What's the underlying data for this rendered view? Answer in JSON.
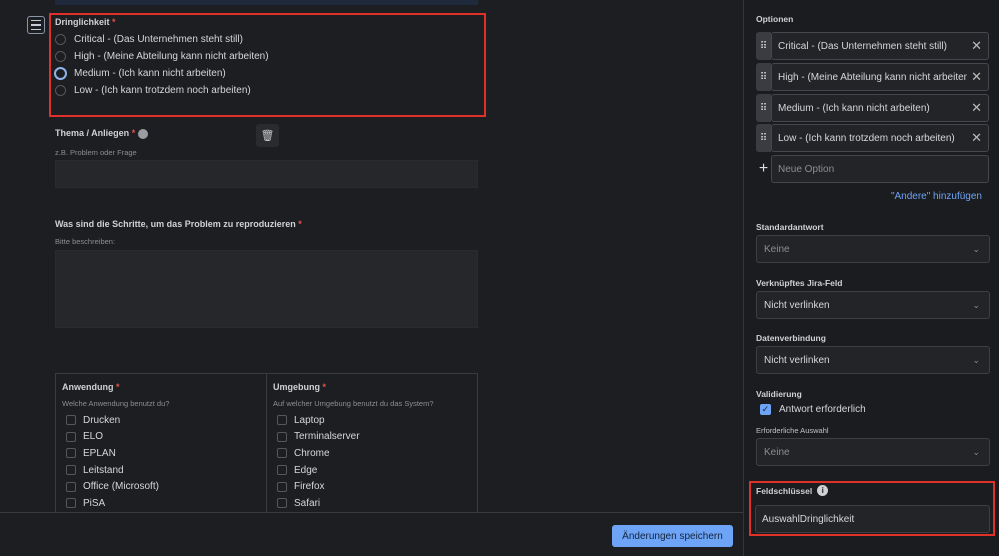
{
  "form": {
    "urgency": {
      "label": "Dringlichkeit",
      "required_mark": "*",
      "options": [
        "Critical - (Das Unternehmen steht still)",
        "High - (Meine Abteilung kann nicht arbeiten)",
        "Medium - (Ich kann nicht arbeiten)",
        "Low - (Ich kann trotzdem noch arbeiten)"
      ]
    },
    "topic": {
      "label": "Thema / Anliegen",
      "required_mark": "*",
      "hint": "z.B. Problem oder Frage"
    },
    "steps": {
      "label": "Was sind die Schritte, um das Problem zu reproduzieren",
      "required_mark": "*",
      "hint": "Bitte beschreiben:"
    },
    "application": {
      "label": "Anwendung",
      "required_mark": "*",
      "hint": "Welche Anwendung benutzt du?",
      "options": [
        "Drucken",
        "ELO",
        "EPLAN",
        "Leitstand",
        "Office (Microsoft)",
        "PiSA"
      ]
    },
    "environment": {
      "label": "Umgebung",
      "required_mark": "*",
      "hint": "Auf welcher Umgebung benutzt du das System?",
      "options": [
        "Laptop",
        "Terminalserver",
        "Chrome",
        "Edge",
        "Firefox",
        "Safari"
      ]
    }
  },
  "footer": {
    "save_label": "Änderungen speichern"
  },
  "panel": {
    "options_label": "Optionen",
    "options": [
      "Critical - (Das Unternehmen steht still)",
      "High - (Meine Abteilung kann nicht arbeiten)",
      "Medium - (Ich kann nicht arbeiten)",
      "Low - (Ich kann trotzdem noch arbeiten)"
    ],
    "new_option_placeholder": "Neue Option",
    "add_other": "\"Andere\" hinzufügen",
    "default_label": "Standardantwort",
    "default_value": "Keine",
    "jira_label": "Verknüpftes Jira-Feld",
    "jira_value": "Nicht verlinken",
    "data_label": "Datenverbindung",
    "data_value": "Nicht verlinken",
    "validation_label": "Validierung",
    "required_answer": "Antwort erforderlich",
    "required_answer_checked": true,
    "required_selection_label": "Erforderliche Auswahl",
    "required_selection_value": "Keine",
    "field_key_label": "Feldschlüssel",
    "field_key_value": "AuswahlDringlichkeit"
  },
  "colors": {
    "accent": "#6ea4f5",
    "highlight": "#e0302a",
    "link": "#6ea4f5"
  }
}
